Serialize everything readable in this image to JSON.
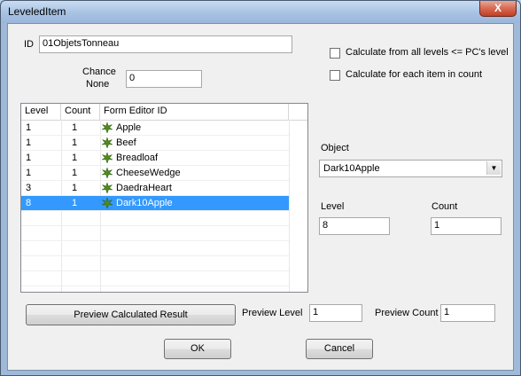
{
  "window": {
    "title": "LeveledItem",
    "close_label": "X"
  },
  "id_field": {
    "label": "ID",
    "value": "01ObjetsTonneau"
  },
  "chance_none": {
    "label_line1": "Chance",
    "label_line2": "None",
    "value": "0"
  },
  "options": {
    "calc_all_levels_label": "Calculate from all levels <= PC's level",
    "calc_each_item_label": "Calculate for each item in count",
    "calc_all_levels_checked": false,
    "calc_each_item_checked": false
  },
  "list": {
    "headers": {
      "level": "Level",
      "count": "Count",
      "form_editor_id": "Form Editor ID"
    },
    "rows": [
      {
        "level": "1",
        "count": "1",
        "id": "Apple",
        "icon": "leaf-icon"
      },
      {
        "level": "1",
        "count": "1",
        "id": "Beef",
        "icon": "leaf-icon"
      },
      {
        "level": "1",
        "count": "1",
        "id": "Breadloaf",
        "icon": "leaf-icon"
      },
      {
        "level": "1",
        "count": "1",
        "id": "CheeseWedge",
        "icon": "leaf-icon"
      },
      {
        "level": "3",
        "count": "1",
        "id": "DaedraHeart",
        "icon": "leaf-icon"
      },
      {
        "level": "8",
        "count": "1",
        "id": "Dark10Apple",
        "icon": "leaf-icon",
        "selected": true
      }
    ]
  },
  "object": {
    "label": "Object",
    "selected": "Dark10Apple"
  },
  "level": {
    "label": "Level",
    "value": "8"
  },
  "count": {
    "label": "Count",
    "value": "1"
  },
  "preview": {
    "button_label": "Preview Calculated Result",
    "level_label": "Preview Level",
    "level_value": "1",
    "count_label": "Preview Count",
    "count_value": "1"
  },
  "buttons": {
    "ok": "OK",
    "cancel": "Cancel"
  },
  "colors": {
    "selection": "#3399ff",
    "leaf": "#4f8a1c"
  }
}
